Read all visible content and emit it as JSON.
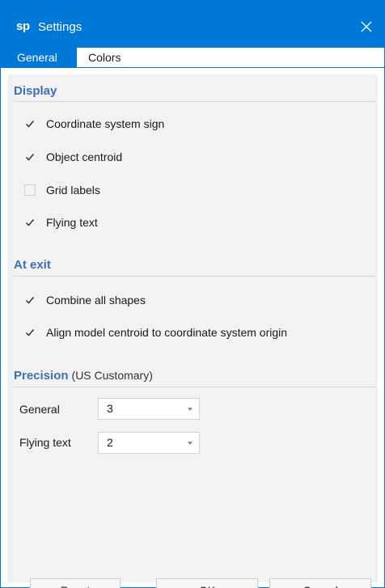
{
  "window": {
    "logo": "sp",
    "title": "Settings",
    "accent_color": "#0078d7"
  },
  "tabs": [
    {
      "label": "General",
      "active": true
    },
    {
      "label": "Colors",
      "active": false
    }
  ],
  "sections": {
    "display": {
      "title": "Display",
      "items": [
        {
          "label": "Coordinate system sign",
          "checked": true
        },
        {
          "label": "Object centroid",
          "checked": true
        },
        {
          "label": "Grid labels",
          "checked": false
        },
        {
          "label": "Flying text",
          "checked": true
        }
      ]
    },
    "at_exit": {
      "title": "At exit",
      "items": [
        {
          "label": "Combine all shapes",
          "checked": true
        },
        {
          "label": "Align model centroid to coordinate system origin",
          "checked": true
        }
      ]
    },
    "precision": {
      "title": "Precision",
      "subtitle": "(US Customary)",
      "fields": [
        {
          "label": "General",
          "value": "3"
        },
        {
          "label": "Flying text",
          "value": "2"
        }
      ]
    }
  },
  "buttons": {
    "reset": "Reset",
    "ok": "OK",
    "cancel": "Cancel"
  },
  "icons": {
    "close": "close-icon",
    "check": "checkmark-icon",
    "dropdown": "chevron-down-icon"
  }
}
